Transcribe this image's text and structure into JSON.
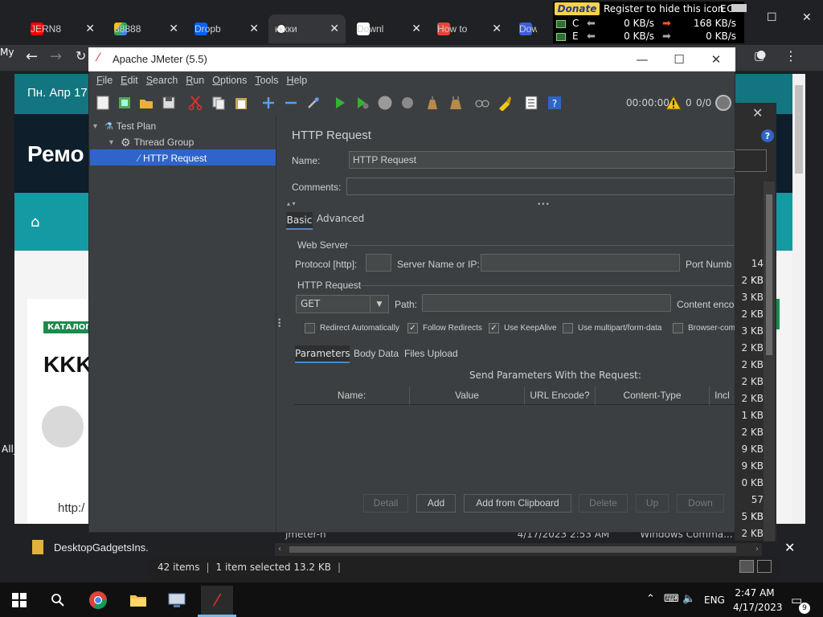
{
  "chrome": {
    "tabs": [
      {
        "label": "JERN8",
        "color": "#ff0000"
      },
      {
        "label": "88888",
        "color": "#34a853"
      },
      {
        "label": "Dropb",
        "color": "#0061fe"
      },
      {
        "label": "кккки",
        "color": "#ffffff"
      },
      {
        "label": "Downl",
        "color": "#ffffff"
      },
      {
        "label": "How to",
        "color": "#ea4335"
      },
      {
        "label": "Dow",
        "color": "#3b5ed8"
      }
    ]
  },
  "netmeter": {
    "donate": "Donate",
    "message": "Register to hide this icon",
    "row1": {
      "drive": "C",
      "down": "0 KB/s",
      "up": "168 KB/s"
    },
    "row2": {
      "drive": "E",
      "down": "0 KB/s",
      "up": "0 KB/s"
    },
    "extra_c": "C",
    "extra_e": "E"
  },
  "webpage": {
    "date": "Пн. Апр 17",
    "brand": "Ремо",
    "badge": "КАТАЛОГ",
    "card_title": "KKK",
    "url_stub": "http:/",
    "desktop_frag_top": "My",
    "desktop_frag_bottom": "All_"
  },
  "download_bar": {
    "file": "DesktopGadgetsIns."
  },
  "explorer": {
    "items": "42 items",
    "selected": "1 item selected  13.2 KB",
    "file_row": {
      "name": "jmeter-n",
      "date": "4/17/2023 2:53 AM",
      "type": "Windows Comma..."
    },
    "sizes": [
      "14 KB",
      "2 KB",
      "3 KB",
      "2 KB",
      "3 KB",
      "2 KB",
      "2 KB",
      "2 KB",
      "2 KB",
      "1 KB",
      "2 KB",
      "9 KB",
      "9 KB",
      "0 KB",
      "57 KB",
      "5 KB",
      "2 KB"
    ]
  },
  "jmeter": {
    "title": "Apache JMeter (5.5)",
    "menu": [
      {
        "key": "F",
        "rest": "ile"
      },
      {
        "key": "E",
        "rest": "dit"
      },
      {
        "key": "S",
        "rest": "earch"
      },
      {
        "key": "R",
        "rest": "un"
      },
      {
        "key": "O",
        "rest": "ptions"
      },
      {
        "key": "T",
        "rest": "ools"
      },
      {
        "key": "H",
        "rest": "elp"
      }
    ],
    "toolbar": {
      "timer": "00:00:00",
      "warnings": "0",
      "threads": "0/0"
    },
    "tree": {
      "test_plan": "Test Plan",
      "thread_group": "Thread Group",
      "http_request": "HTTP Request"
    },
    "panel": {
      "title": "HTTP Request",
      "name_label": "Name:",
      "name_value": "HTTP Request",
      "comments_label": "Comments:",
      "tab_basic": "Basic",
      "tab_advanced": "Advanced",
      "web_server": "Web Server",
      "protocol_label": "Protocol [http]:",
      "server_label": "Server Name or IP:",
      "port_label": "Port Numb",
      "http_request_group": "HTTP Request",
      "method": "GET",
      "path_label": "Path:",
      "content_enc_label": "Content enco",
      "checkboxes": [
        {
          "label": "Redirect Automatically",
          "checked": false
        },
        {
          "label": "Follow Redirects",
          "checked": true
        },
        {
          "label": "Use KeepAlive",
          "checked": true
        },
        {
          "label": "Use multipart/form-data",
          "checked": false
        },
        {
          "label": "Browser-com",
          "checked": false
        }
      ],
      "subtabs": [
        "Parameters",
        "Body Data",
        "Files Upload"
      ],
      "send_params": "Send Parameters With the Request:",
      "columns": [
        "Name:",
        "Value",
        "URL Encode?",
        "Content-Type",
        "Incl"
      ],
      "buttons": {
        "detail": "Detail",
        "add": "Add",
        "add_clipboard": "Add from Clipboard",
        "delete": "Delete",
        "up": "Up",
        "down": "Down"
      }
    }
  },
  "taskbar": {
    "lang": "ENG",
    "time": "2:47 AM",
    "date": "4/17/2023",
    "notifications": "9"
  },
  "colors": {
    "selection": "#2f65ca",
    "jmeter_bg": "#3c3f41",
    "accent_teal": "#13757f"
  }
}
